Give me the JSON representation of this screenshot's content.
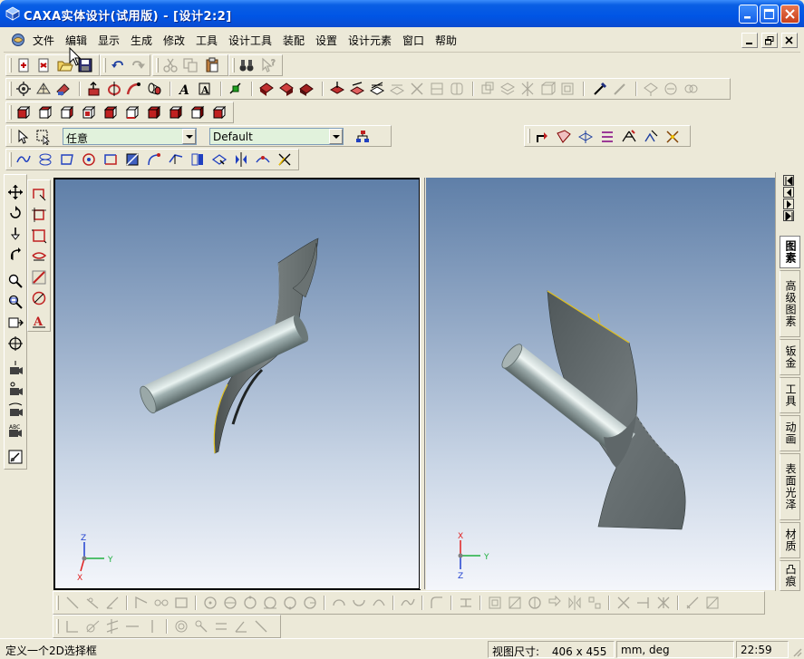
{
  "window": {
    "title": "CAXA实体设计(试用版) - [设计2:2]"
  },
  "menu": {
    "items": [
      "文件",
      "编辑",
      "显示",
      "生成",
      "修改",
      "工具",
      "设计工具",
      "装配",
      "设置",
      "设计元素",
      "窗口",
      "帮助"
    ]
  },
  "selection_bar": {
    "filter_value": "任意",
    "style_value": "Default"
  },
  "right_tabs": [
    {
      "label": "图素",
      "active": true
    },
    {
      "label": "高级图素",
      "active": false
    },
    {
      "label": "钣金",
      "active": false
    },
    {
      "label": "工具",
      "active": false
    },
    {
      "label": "动画",
      "active": false
    },
    {
      "label": "表面光泽",
      "active": false
    },
    {
      "label": "材质",
      "active": false
    },
    {
      "label": "凸痕",
      "active": false
    }
  ],
  "axes": {
    "x_label": "X",
    "y_label": "Y",
    "z_label": "Z"
  },
  "colors": {
    "titlebar": "#0055e5",
    "viewport_top": "#5f7fa8",
    "viewport_bottom": "#f4f6fb",
    "combo_bg": "#e1f2dc",
    "axis_x": "#e02020",
    "axis_y": "#20b040",
    "axis_z": "#2040d0"
  },
  "status": {
    "prompt": "定义一个2D选择框",
    "view_size_label": "视图尺寸:",
    "view_size_value": "406 x 455",
    "units": "mm, deg",
    "time": "22:59"
  }
}
